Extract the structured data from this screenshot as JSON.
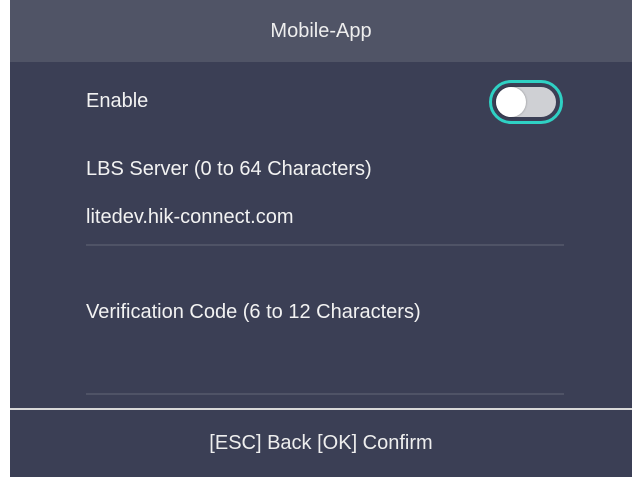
{
  "header": {
    "title": "Mobile-App"
  },
  "settings": {
    "enable_label": "Enable",
    "enable_on": false,
    "lbs_label": "LBS Server (0 to 64 Characters)",
    "lbs_value": "litedev.hik-connect.com",
    "verification_label": "Verification Code (6 to 12 Characters)",
    "verification_value": ""
  },
  "footer": {
    "hint": "[ESC] Back [OK] Confirm"
  },
  "colors": {
    "accent": "#2fd1c4",
    "background": "#3b3f55",
    "header_bg": "#505466"
  },
  "icons": {
    "toggle": "enable-toggle"
  }
}
